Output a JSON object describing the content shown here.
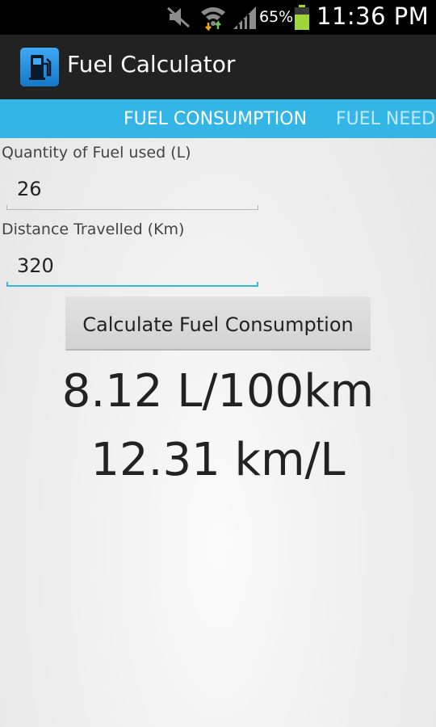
{
  "status_bar": {
    "battery_percent": "65%",
    "time": "11:36 PM",
    "icons": [
      "mute-icon",
      "wifi-icon",
      "signal-icon",
      "battery-icon"
    ]
  },
  "action_bar": {
    "title": "Fuel Calculator",
    "icon": "fuel-pump-icon",
    "icon_color": "#2a8fe0"
  },
  "tabs": [
    {
      "label": "FUEL CONSUMPTION",
      "active": true
    },
    {
      "label": "FUEL NEED",
      "active": false
    }
  ],
  "form": {
    "quantity_label": "Quantity of Fuel used (L)",
    "quantity_value": "26",
    "distance_label": "Distance Travelled (Km)",
    "distance_value": "320",
    "button_label": "Calculate Fuel Consumption"
  },
  "results": {
    "per_100km": "8.12 L/100km",
    "km_per_l": "12.31 km/L"
  },
  "colors": {
    "tab_strip": "#33b5e5",
    "action_bar": "#222222",
    "focus_underline": "#33b5e5"
  }
}
